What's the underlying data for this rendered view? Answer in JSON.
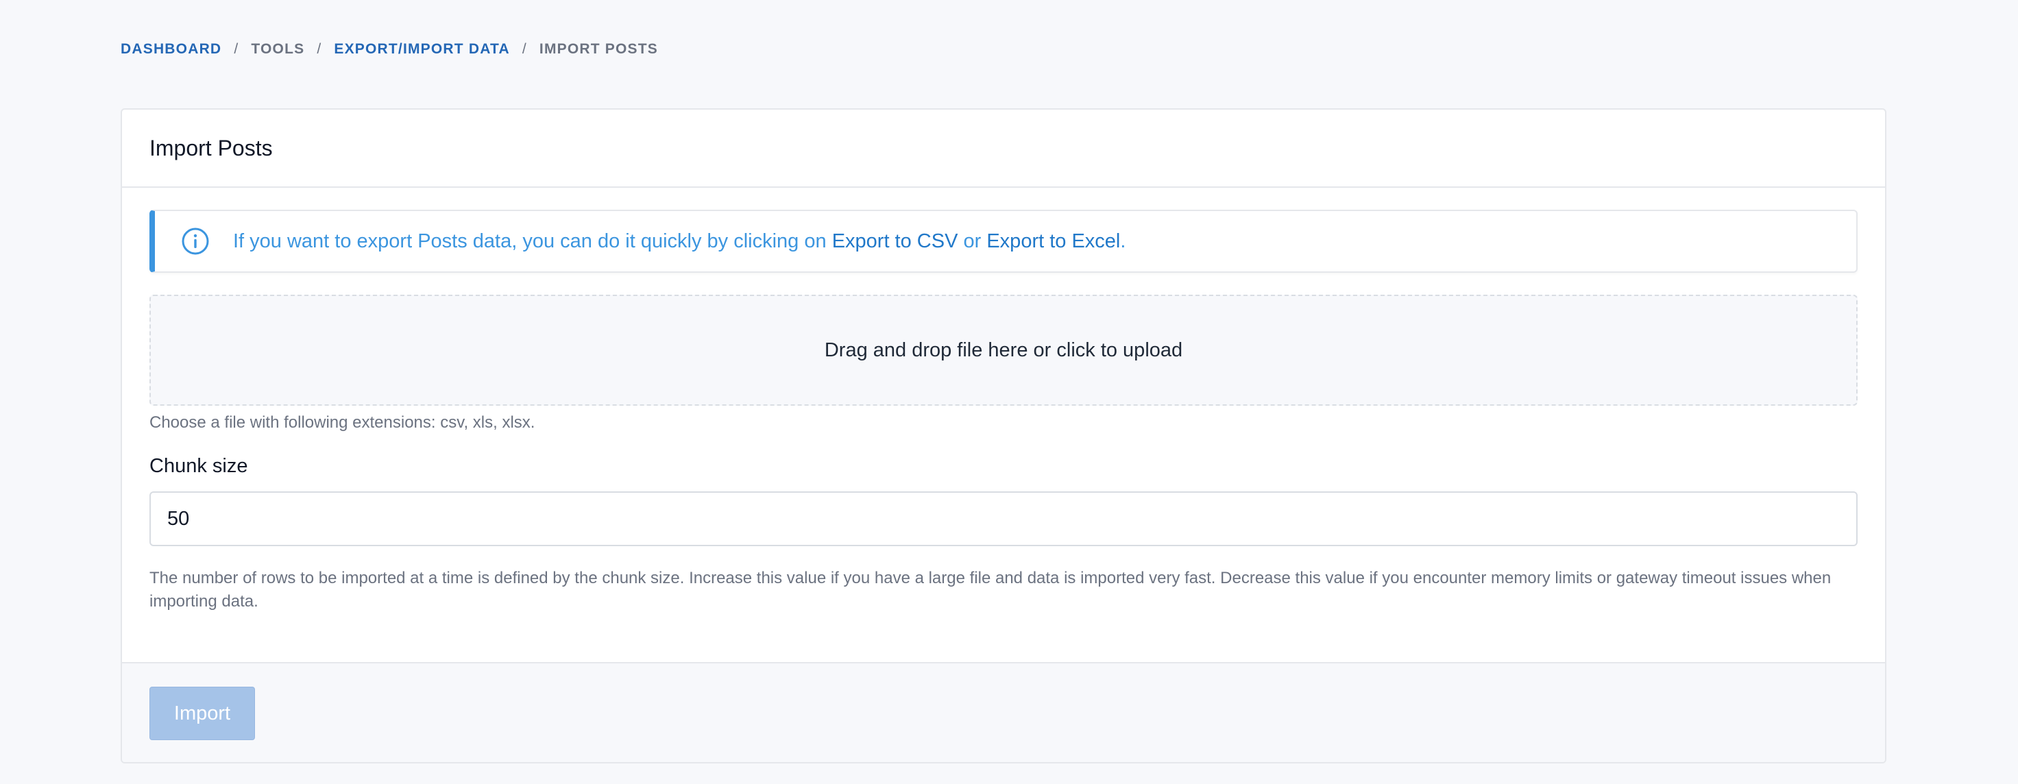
{
  "breadcrumb": {
    "items": [
      {
        "label": "Dashboard",
        "link": true
      },
      {
        "label": "Tools",
        "link": false
      },
      {
        "label": "Export/Import Data",
        "link": true
      },
      {
        "label": "Import Posts",
        "link": false
      }
    ],
    "separator": "/"
  },
  "card": {
    "title": "Import Posts"
  },
  "alert": {
    "icon": "info-icon",
    "text_before": "If you want to export Posts data, you can do it quickly by clicking on ",
    "link_csv": "Export to CSV",
    "text_or": " or ",
    "link_excel": "Export to Excel",
    "text_after": "."
  },
  "upload": {
    "dropzone_text": "Drag and drop file here or click to upload",
    "help": "Choose a file with following extensions: csv, xls, xlsx."
  },
  "chunk": {
    "label": "Chunk size",
    "value": "50",
    "help": "The number of rows to be imported at a time is defined by the chunk size. Increase this value if you have a large file and data is imported very fast. Decrease this value if you encounter memory limits or gateway timeout issues when importing data."
  },
  "footer": {
    "import_label": "Import"
  },
  "colors": {
    "link": "#2467b5",
    "alert_accent": "#3b95df",
    "button_disabled": "#a5c3e8"
  }
}
